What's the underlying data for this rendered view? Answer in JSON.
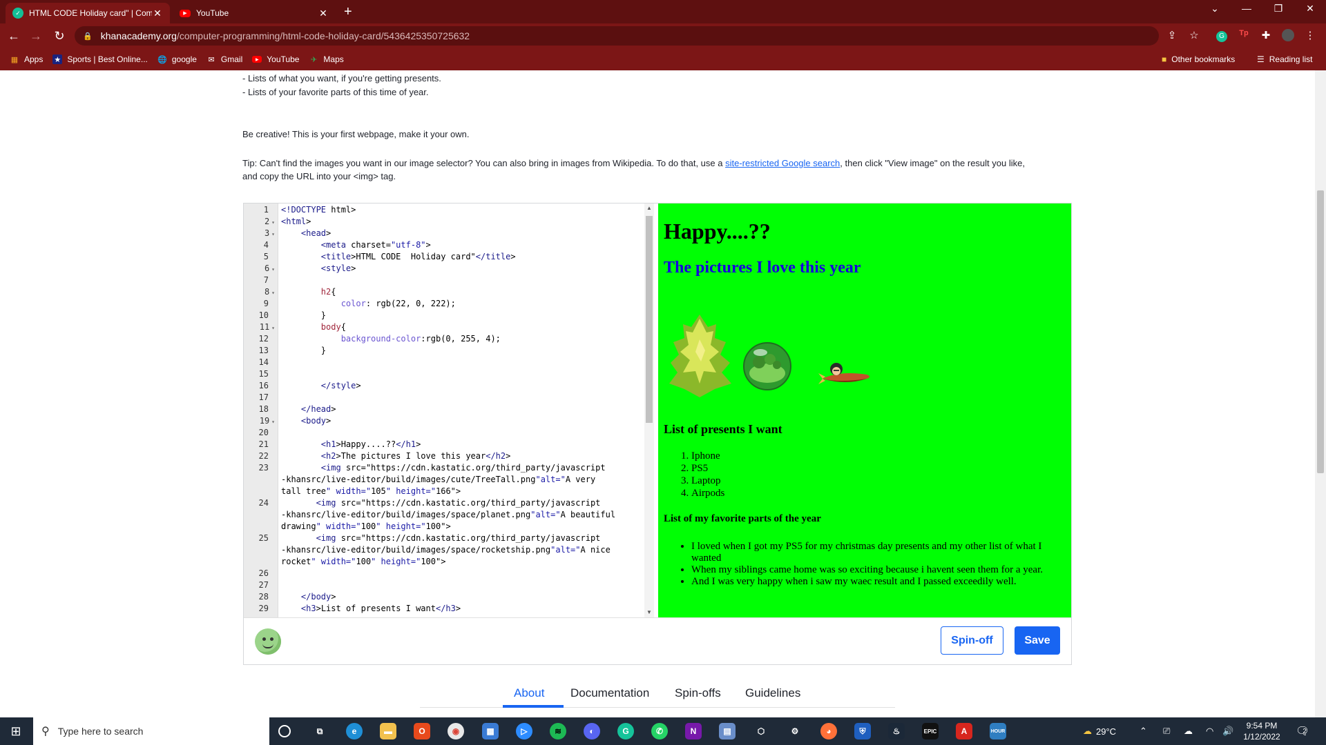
{
  "browser": {
    "tabs": [
      {
        "title": "HTML CODE Holiday card\" | Com",
        "close": "✕"
      },
      {
        "title": "YouTube",
        "close": "✕"
      }
    ],
    "url_host": "khanacademy.org",
    "url_path": "/computer-programming/html-code-holiday-card/5436425350725632",
    "bookmarks": [
      "Apps",
      "Sports | Best Online...",
      "google",
      "Gmail",
      "YouTube",
      "Maps"
    ],
    "other_bookmarks": "Other bookmarks",
    "reading_list": "Reading list"
  },
  "description": {
    "line1": "- Lists of what you want, if you're getting presents.",
    "line2": "- Lists of your favorite parts of this time of year.",
    "creative": "Be creative! This is your first webpage, make it your own.",
    "tip_before": "Tip: Can't find the images you want in our image selector? You can also bring in images from Wikipedia. To do that, use a ",
    "tip_link": "site-restricted Google search",
    "tip_after": ", then click \"View image\" on the result you like,",
    "tip_line2": "and copy the URL into your <img> tag."
  },
  "editor": {
    "lines": [
      {
        "n": "1",
        "text": "<!DOCTYPE html>",
        "fold": false
      },
      {
        "n": "2",
        "text": "<html>",
        "fold": true
      },
      {
        "n": "3",
        "text": "    <head>",
        "fold": true
      },
      {
        "n": "4",
        "text": "        <meta charset=\"utf-8\">",
        "fold": false
      },
      {
        "n": "5",
        "text": "        <title>HTML CODE  Holiday card\"</title>",
        "fold": false
      },
      {
        "n": "6",
        "text": "        <style>",
        "fold": true
      },
      {
        "n": "7",
        "text": "",
        "fold": false
      },
      {
        "n": "8",
        "text": "        h2{",
        "fold": true
      },
      {
        "n": "9",
        "text": "            color: rgb(22, 0, 222);",
        "fold": false
      },
      {
        "n": "10",
        "text": "        }",
        "fold": false
      },
      {
        "n": "11",
        "text": "        body{",
        "fold": true
      },
      {
        "n": "12",
        "text": "            background-color:rgb(0, 255, 4);",
        "fold": false
      },
      {
        "n": "13",
        "text": "        }",
        "fold": false
      },
      {
        "n": "14",
        "text": "",
        "fold": false
      },
      {
        "n": "15",
        "text": "",
        "fold": false
      },
      {
        "n": "16",
        "text": "        </style>",
        "fold": false
      },
      {
        "n": "17",
        "text": "",
        "fold": false
      },
      {
        "n": "18",
        "text": "    </head>",
        "fold": false
      },
      {
        "n": "19",
        "text": "    <body>",
        "fold": true
      },
      {
        "n": "20",
        "text": "",
        "fold": false
      },
      {
        "n": "21",
        "text": "        <h1>Happy....??</h1>",
        "fold": false
      },
      {
        "n": "22",
        "text": "        <h2>The pictures I love this year</h2>",
        "fold": false
      },
      {
        "n": "23",
        "text": "        <img src=\"https://cdn.kastatic.org/third_party/javascript",
        "fold": false
      },
      {
        "n": "",
        "text": "-khansrc/live-editor/build/images/cute/TreeTall.png\"alt=\"A very",
        "fold": false
      },
      {
        "n": "",
        "text": "tall tree\" width=\"105\" height=\"166\">",
        "fold": false
      },
      {
        "n": "24",
        "text": "       <img src=\"https://cdn.kastatic.org/third_party/javascript",
        "fold": false
      },
      {
        "n": "",
        "text": "-khansrc/live-editor/build/images/space/planet.png\"alt=\"A beautiful",
        "fold": false
      },
      {
        "n": "",
        "text": "drawing\" width=\"100\" height=\"100\">",
        "fold": false
      },
      {
        "n": "25",
        "text": "       <img src=\"https://cdn.kastatic.org/third_party/javascript",
        "fold": false
      },
      {
        "n": "",
        "text": "-khansrc/live-editor/build/images/space/rocketship.png\"alt=\"A nice",
        "fold": false
      },
      {
        "n": "",
        "text": "rocket\" width=\"100\" height=\"100\">",
        "fold": false
      },
      {
        "n": "26",
        "text": "",
        "fold": false
      },
      {
        "n": "27",
        "text": "",
        "fold": false
      },
      {
        "n": "28",
        "text": "    </body>",
        "fold": false
      },
      {
        "n": "29",
        "text": "    <h3>List of presents I want</h3>",
        "fold": false
      }
    ]
  },
  "output": {
    "h1": "Happy....??",
    "h2": "The pictures I love this year",
    "h3": "List of presents I want",
    "presents": [
      "Iphone",
      "PS5",
      "Laptop",
      "Airpods"
    ],
    "h4": "List of my favorite parts of the year",
    "favorites": [
      "I loved when I got my PS5 for my christmas day presents and my other list of what I wanted",
      "When my siblings came home was so exciting because i havent seen them for a year.",
      "And I was very happy when i saw my waec result and I passed exceedily well."
    ],
    "bg_color": "#00ff04",
    "h2_color": "#1600de"
  },
  "actions": {
    "spinoff": "Spin-off",
    "save": "Save"
  },
  "bottom_tabs": [
    "About",
    "Documentation",
    "Spin-offs",
    "Guidelines"
  ],
  "taskbar": {
    "search_placeholder": "Type here to search",
    "weather": "29°C",
    "time": "9:54 PM",
    "date": "1/12/2022",
    "notifications": "2"
  }
}
